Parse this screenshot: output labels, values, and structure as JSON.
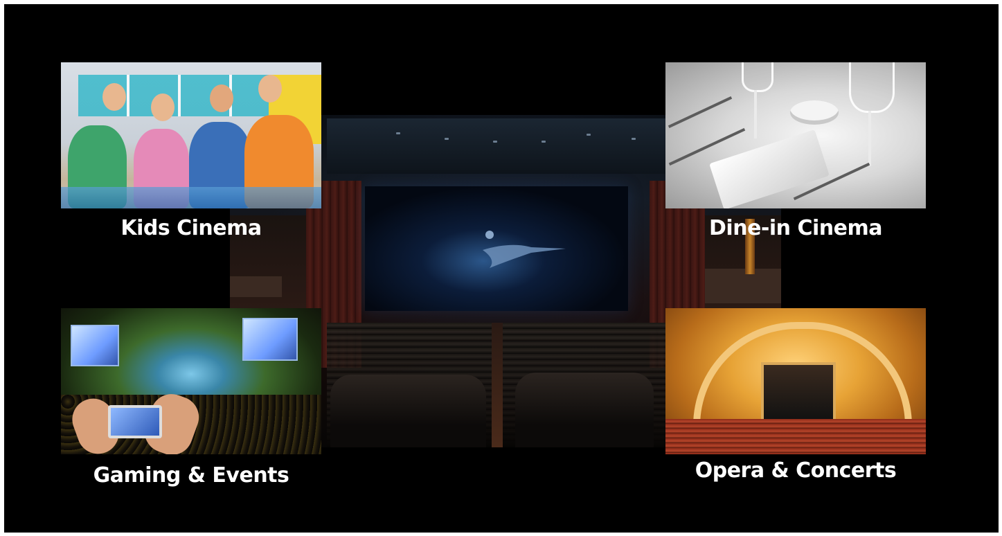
{
  "tiles": {
    "kids": {
      "caption": "Kids Cinema"
    },
    "dine": {
      "caption": "Dine-in Cinema"
    },
    "gaming": {
      "caption": "Gaming & Events"
    },
    "opera": {
      "caption": "Opera & Concerts"
    }
  },
  "colors": {
    "background": "#000000",
    "caption": "#ffffff"
  }
}
